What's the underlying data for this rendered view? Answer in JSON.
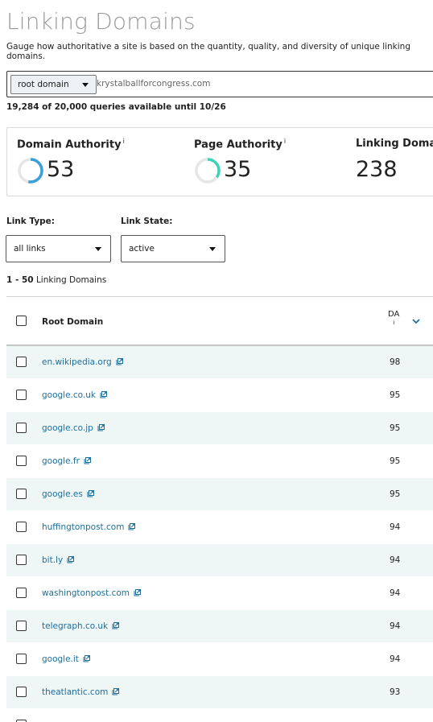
{
  "header": {
    "title": "Linking Domains",
    "subtitle": "Gauge how authoritative a site is based on the quantity, quality, and diversity of unique linking domains."
  },
  "search": {
    "scope": "root domain",
    "value": "krystalballforcongress.com"
  },
  "quota": "19,284 of 20,000 queries available until 10/26",
  "metrics": [
    {
      "label": "Domain Authority",
      "info": "i",
      "value": "53",
      "ring_fraction": 0.53,
      "ring_color": "#3aa0d8"
    },
    {
      "label": "Page Authority",
      "info": "i",
      "value": "35",
      "ring_fraction": 0.35,
      "ring_color": "#3fd3b5"
    },
    {
      "label": "Linking Domains",
      "value": "238"
    }
  ],
  "filters": {
    "link_type_label": "Link Type:",
    "link_type_value": "all links",
    "link_state_label": "Link State:",
    "link_state_value": "active"
  },
  "range": {
    "span": "1 - 50",
    "label": "Linking Domains"
  },
  "table": {
    "col_root": "Root Domain",
    "col_da": "DA",
    "col_da_info": "i",
    "rows": [
      {
        "domain": "en.wikipedia.org",
        "da": "98"
      },
      {
        "domain": "google.co.uk",
        "da": "95"
      },
      {
        "domain": "google.co.jp",
        "da": "95"
      },
      {
        "domain": "google.fr",
        "da": "95"
      },
      {
        "domain": "google.es",
        "da": "95"
      },
      {
        "domain": "huffingtonpost.com",
        "da": "94"
      },
      {
        "domain": "bit.ly",
        "da": "94"
      },
      {
        "domain": "washingtonpost.com",
        "da": "94"
      },
      {
        "domain": "telegraph.co.uk",
        "da": "94"
      },
      {
        "domain": "google.it",
        "da": "94"
      },
      {
        "domain": "theatlantic.com",
        "da": "93"
      }
    ]
  },
  "colors": {
    "link": "#1b6f9c",
    "row_alt": "#eff6f6",
    "accent": "#1b6f9c"
  },
  "icons": {
    "external": "external-link-icon",
    "sort": "chevron-down-icon"
  }
}
